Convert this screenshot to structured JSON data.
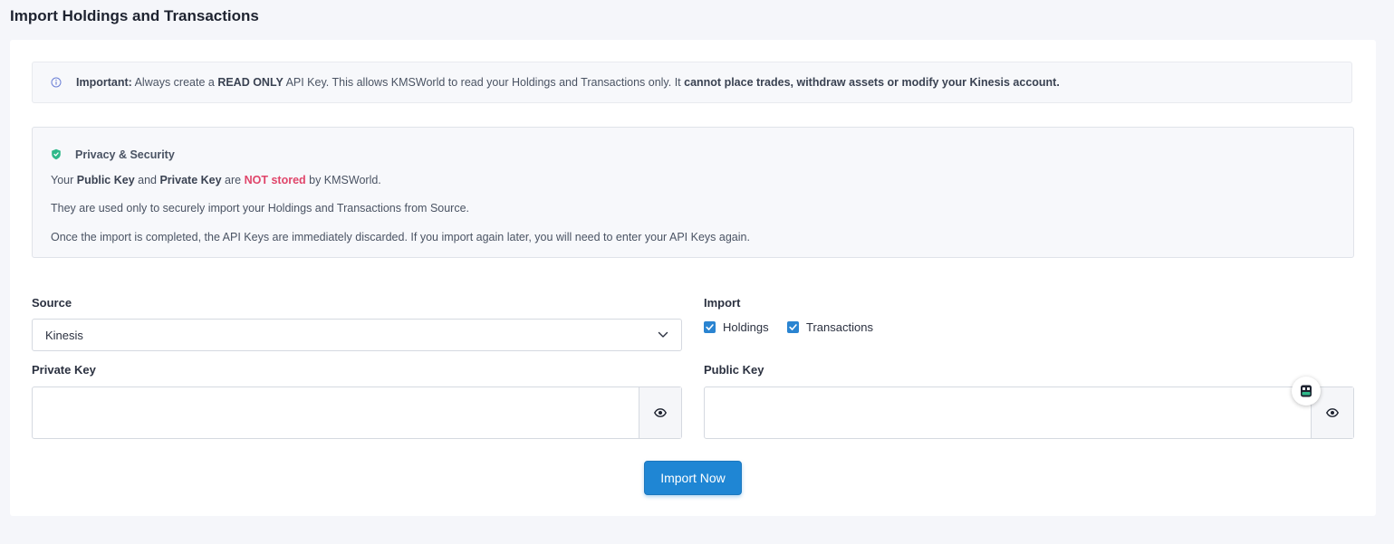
{
  "page": {
    "title": "Import Holdings and Transactions"
  },
  "notice": {
    "lead": "Important:",
    "t1": " Always create a ",
    "b1": "READ ONLY",
    "t2": " API Key. This allows KMSWorld to read your Holdings and Transactions only. It ",
    "b2": "cannot place trades, withdraw assets or modify your Kinesis account."
  },
  "privacy": {
    "title": "Privacy & Security",
    "l1_t1": "Your ",
    "l1_b1": "Public Key",
    "l1_t2": " and ",
    "l1_b2": "Private Key",
    "l1_t3": " are ",
    "l1_danger": "NOT stored",
    "l1_t4": " by KMSWorld.",
    "line2": "They are used only to securely import your Holdings and Transactions from Source.",
    "line3": "Once the import is completed, the API Keys are immediately discarded. If you import again later, you will need to enter your API Keys again."
  },
  "form": {
    "source_label": "Source",
    "source_value": "Kinesis",
    "import_label": "Import",
    "holdings_label": "Holdings",
    "transactions_label": "Transactions",
    "private_key_label": "Private Key",
    "private_key_value": "",
    "public_key_label": "Public Key",
    "public_key_value": "",
    "submit_label": "Import Now"
  },
  "colors": {
    "accent": "#1f86d4",
    "danger": "#e0456a",
    "shield": "#2fb98a"
  },
  "icons": [
    "info-icon",
    "shield-icon",
    "chevron-down-icon",
    "checkmark-icon",
    "eye-icon",
    "robot-icon"
  ]
}
